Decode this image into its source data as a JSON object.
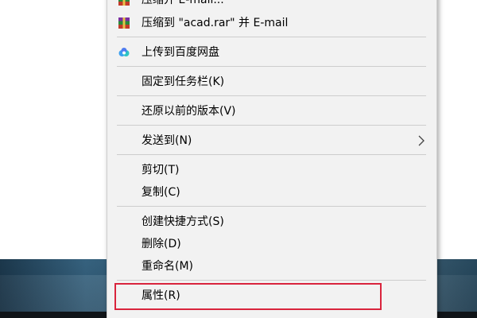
{
  "context_menu": {
    "items": [
      {
        "label": "压缩并 E-mail...",
        "icon": "winrar-icon"
      },
      {
        "label": "压缩到 \"acad.rar\" 并 E-mail",
        "icon": "winrar-icon"
      },
      {
        "label": "上传到百度网盘",
        "icon": "baidu-netdisk-icon"
      },
      {
        "label": "固定到任务栏(K)"
      },
      {
        "label": "还原以前的版本(V)"
      },
      {
        "label": "发送到(N)",
        "submenu": true,
        "submenu_icon": "chevron-right-icon"
      },
      {
        "label": "剪切(T)"
      },
      {
        "label": "复制(C)"
      },
      {
        "label": "创建快捷方式(S)"
      },
      {
        "label": "删除(D)"
      },
      {
        "label": "重命名(M)"
      },
      {
        "label": "属性(R)",
        "highlighted": true
      }
    ]
  },
  "colors": {
    "menu_bg": "#f2f2f2",
    "separator": "#cdcdcd",
    "highlight_border": "#d9243d"
  }
}
